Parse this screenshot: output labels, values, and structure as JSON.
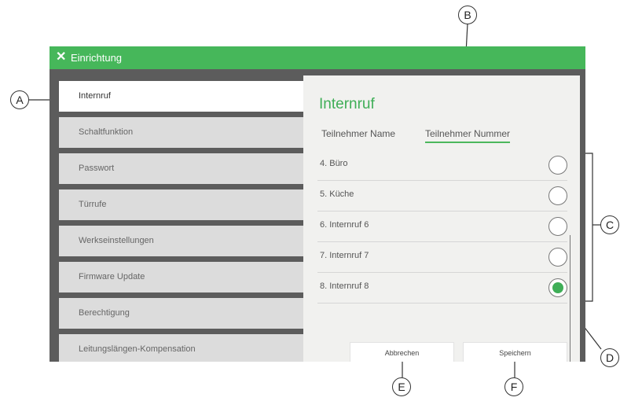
{
  "window": {
    "title": "Einrichtung",
    "accent": "#46b75a"
  },
  "sidebar": {
    "items": [
      {
        "label": "Internruf",
        "active": true
      },
      {
        "label": "Schaltfunktion"
      },
      {
        "label": "Passwort"
      },
      {
        "label": "Türrufe"
      },
      {
        "label": "Werkseinstellungen"
      },
      {
        "label": "Firmware Update"
      },
      {
        "label": "Berechtigung"
      },
      {
        "label": "Leitungslängen-Kompensation"
      }
    ]
  },
  "panel": {
    "title": "Internruf",
    "tabs": [
      {
        "label": "Teilnehmer Name"
      },
      {
        "label": "Teilnehmer Nummer",
        "active": true
      }
    ],
    "rows": [
      {
        "label": "4. Büro",
        "selected": false
      },
      {
        "label": "5. Küche",
        "selected": false
      },
      {
        "label": "6. Internruf 6",
        "selected": false
      },
      {
        "label": "7. Internruf 7",
        "selected": false
      },
      {
        "label": "8. Internruf 8",
        "selected": true
      }
    ],
    "buttons": {
      "cancel": "Abbrechen",
      "save": "Speichern"
    }
  },
  "callouts": {
    "a": "A",
    "b": "B",
    "c": "C",
    "d": "D",
    "e": "E",
    "f": "F"
  }
}
